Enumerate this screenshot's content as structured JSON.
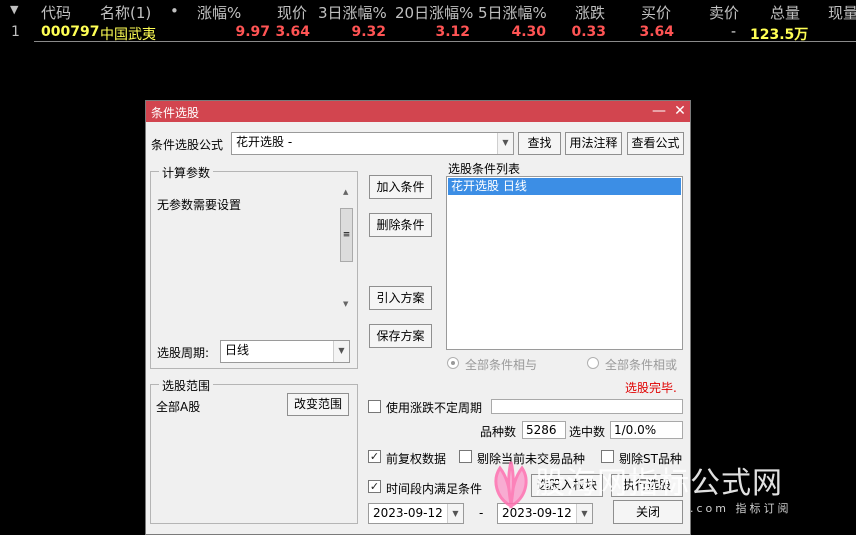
{
  "quote_table": {
    "headers": {
      "sort_icon": "▼",
      "code": "代码",
      "name": "名称(1)",
      "dot": "•",
      "pct": "涨幅%",
      "price": "现价",
      "pct3": "3日涨幅%",
      "pct20": "20日涨幅%",
      "pct5": "5日涨幅%",
      "change": "涨跌",
      "bid": "买价",
      "ask": "卖价",
      "volume": "总量",
      "cur_volume": "现量"
    },
    "rows": [
      {
        "idx": "1",
        "code": "000797",
        "name": "中国武夷",
        "pct": "9.97",
        "price": "3.64",
        "pct3": "9.32",
        "pct20": "3.12",
        "pct5": "4.30",
        "change": "0.33",
        "bid": "3.64",
        "ask": "-",
        "volume": "123.5万"
      }
    ]
  },
  "dialog": {
    "title": "条件选股",
    "formula_label": "条件选股公式",
    "formula_value": "花开选股  -",
    "find_btn": "查找",
    "usage_btn": "用法注释",
    "view_formula_btn": "查看公式",
    "params_group": "计算参数",
    "params_text": "无参数需要设置",
    "period_label": "选股周期:",
    "period_value": "日线",
    "add_cond_btn": "加入条件",
    "del_cond_btn": "删除条件",
    "import_plan_btn": "引入方案",
    "save_plan_btn": "保存方案",
    "cond_list_label": "选股条件列表",
    "cond_list": [
      "花开选股  日线"
    ],
    "all_and": "全部条件相与",
    "all_or": "全部条件相或",
    "status": "选股完毕.",
    "range_group": "选股范围",
    "range_value": "全部A股",
    "change_range_btn": "改变范围",
    "use_variable_period": "使用涨跌不定周期",
    "count_label": "品种数",
    "count_value": "5286",
    "selected_label": "选中数",
    "selected_value": "1/0.0%",
    "pre_adjust": "前复权数据",
    "exclude_suspended": "剔除当前未交易品种",
    "exclude_st": "剔除ST品种",
    "time_range": "时间段内满足条件",
    "join_block_btn": "选股入板块",
    "run_btn": "执行选股",
    "date_from": "2023-09-12",
    "date_to": "2023-09-12",
    "date_sep": "-",
    "close_btn": "关闭"
  },
  "watermark": {
    "text": "股海网指标公式网",
    "sub": ".com  指标订阅"
  },
  "colors": {
    "title_bar": "#d2454f",
    "quote_yellow": "#ffff54",
    "quote_red": "#ff5454",
    "selection_blue": "#3c8ee5",
    "status_red": "#e00000"
  }
}
